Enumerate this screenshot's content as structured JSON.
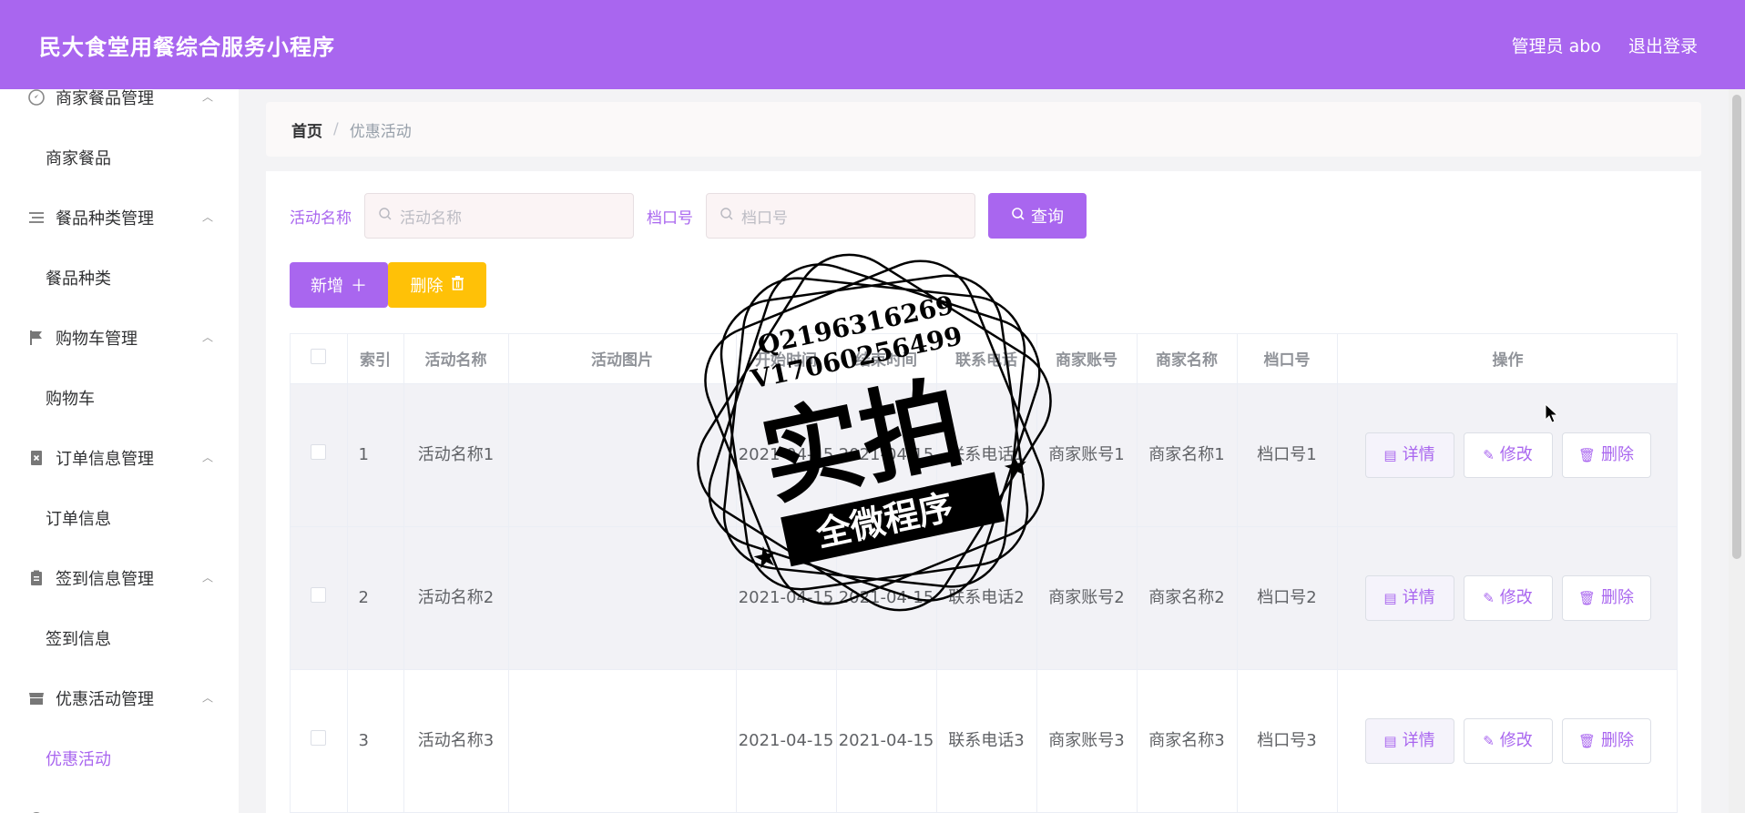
{
  "header": {
    "app_title": "民大食堂用餐综合服务小程序",
    "user": "管理员 abo",
    "logout": "退出登录"
  },
  "sidebar": {
    "groups": [
      {
        "title": "商家餐品管理",
        "icon": "compass-icon",
        "items": [
          "商家餐品"
        ]
      },
      {
        "title": "餐品种类管理",
        "icon": "list-icon",
        "items": [
          "餐品种类"
        ]
      },
      {
        "title": "购物车管理",
        "icon": "flag-icon",
        "items": [
          "购物车"
        ]
      },
      {
        "title": "订单信息管理",
        "icon": "doc-x-icon",
        "items": [
          "订单信息"
        ]
      },
      {
        "title": "签到信息管理",
        "icon": "clipboard-icon",
        "items": [
          "签到信息"
        ]
      },
      {
        "title": "优惠活动管理",
        "icon": "store-icon",
        "items": [
          "优惠活动"
        ]
      }
    ],
    "active_item": "优惠活动"
  },
  "breadcrumb": {
    "home": "首页",
    "current": "优惠活动"
  },
  "search": {
    "field1_label": "活动名称",
    "field1_placeholder": "活动名称",
    "field2_label": "档口号",
    "field2_placeholder": "档口号",
    "query_button": "查询"
  },
  "actions": {
    "add": "新增",
    "delete": "删除"
  },
  "table": {
    "headers": [
      "索引",
      "活动名称",
      "活动图片",
      "开始时间",
      "结束时间",
      "联系电话",
      "商家账号",
      "商家名称",
      "档口号",
      "操作"
    ],
    "rows": [
      {
        "index": "1",
        "name": "活动名称1",
        "start": "2021-04-15",
        "end": "2021-04-15",
        "phone": "联系电话1",
        "account": "商家账号1",
        "merchant": "商家名称1",
        "stall": "档口号1"
      },
      {
        "index": "2",
        "name": "活动名称2",
        "start": "2021-04-15",
        "end": "2021-04-15",
        "phone": "联系电话2",
        "account": "商家账号2",
        "merchant": "商家名称2",
        "stall": "档口号2"
      },
      {
        "index": "3",
        "name": "活动名称3",
        "start": "2021-04-15",
        "end": "2021-04-15",
        "phone": "联系电话3",
        "account": "商家账号3",
        "merchant": "商家名称3",
        "stall": "档口号3"
      }
    ],
    "op_labels": {
      "detail": "详情",
      "edit": "修改",
      "delete": "删除"
    }
  },
  "watermark": {
    "line1": "Q2196316269",
    "line2": "V17060256499",
    "main": "实拍",
    "banner": "全微程序"
  },
  "colors": {
    "primary": "#a966ef",
    "warning": "#ffc107"
  }
}
